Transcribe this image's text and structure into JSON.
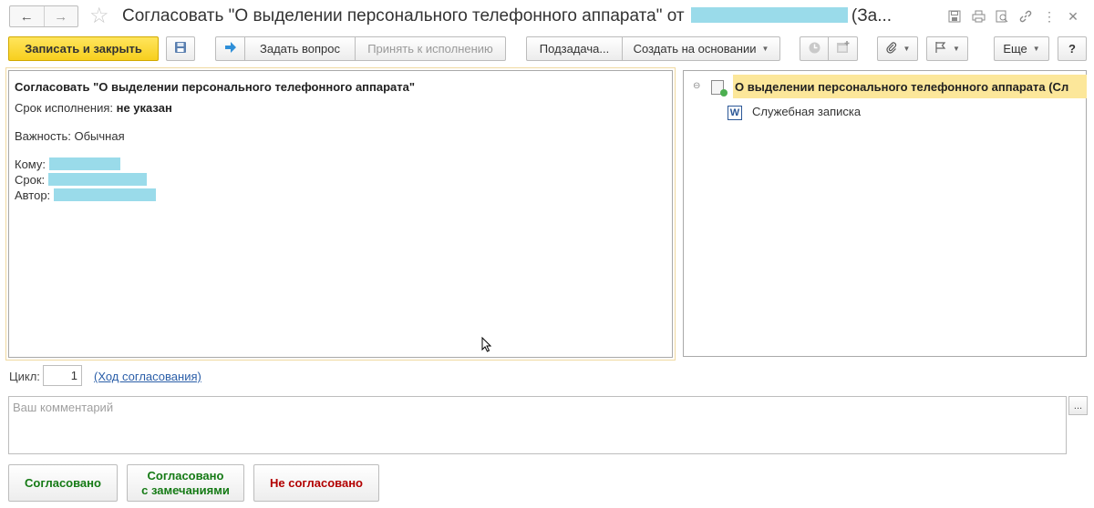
{
  "window": {
    "title_prefix": "Согласовать \"О выделении персонального телефонного аппарата\" от",
    "title_suffix": "(За..."
  },
  "toolbar": {
    "save_close": "Записать и закрыть",
    "ask_question": "Задать вопрос",
    "accept": "Принять к исполнению",
    "subtask": "Подзадача...",
    "create_based": "Создать на основании",
    "more": "Еще",
    "help": "?"
  },
  "task": {
    "subject": "Согласовать \"О выделении персонального телефонного аппарата\"",
    "deadline_label": "Срок исполнения:",
    "deadline_value": "не указан",
    "importance_label": "Важность:",
    "importance_value": "Обычная",
    "to_label": "Кому:",
    "due_label": "Срок:",
    "author_label": "Автор:"
  },
  "tree": {
    "root": "О выделении персонального телефонного аппарата (Сл",
    "child": "Служебная записка",
    "child_icon": "W"
  },
  "cycle": {
    "label": "Цикл:",
    "value": "1",
    "link": "(Ход согласования)"
  },
  "comment": {
    "placeholder": "Ваш комментарий",
    "button": "..."
  },
  "actions": {
    "approved": "Согласовано",
    "approved_remarks_line1": "Согласовано",
    "approved_remarks_line2": "с замечаниями",
    "rejected": "Не согласовано"
  },
  "colors": {
    "accent_yellow": "#f7cf1e",
    "approve_green": "#157a15",
    "reject_red": "#b20000",
    "highlight": "#fce79a",
    "redaction": "#9adbea"
  }
}
